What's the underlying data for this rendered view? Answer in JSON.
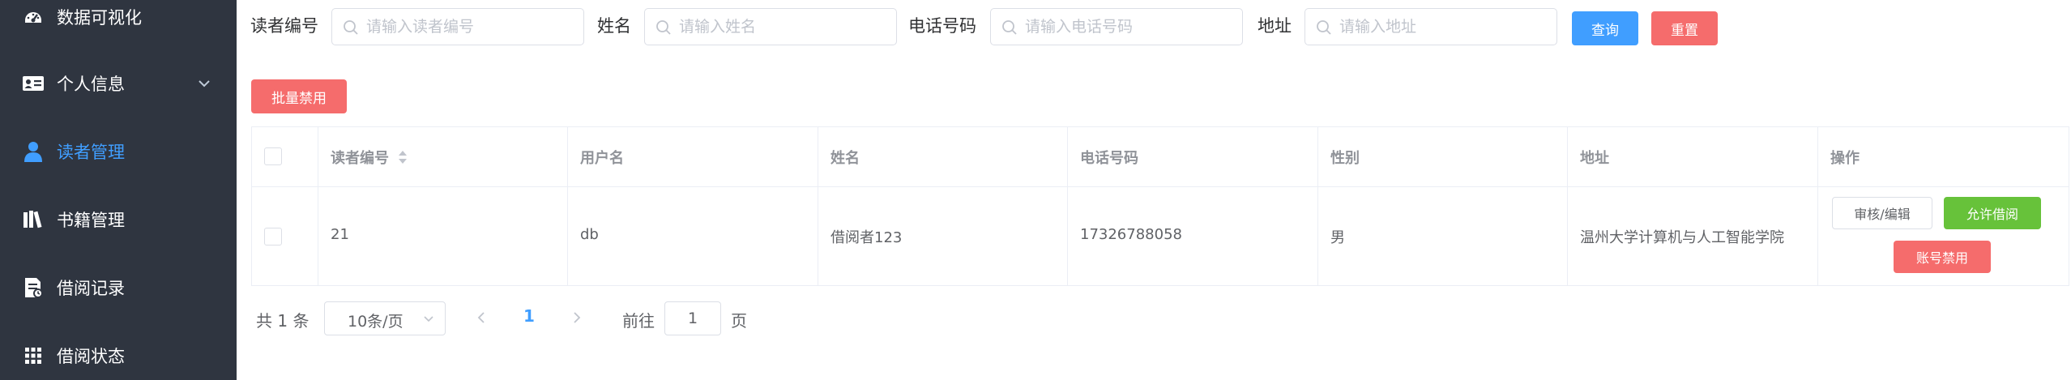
{
  "sidebar": {
    "items": [
      {
        "label": "数据可视化",
        "icon": "dashboard-icon"
      },
      {
        "label": "个人信息",
        "icon": "id-card-icon",
        "has_submenu": true
      },
      {
        "label": "读者管理",
        "icon": "user-icon",
        "active": true
      },
      {
        "label": "书籍管理",
        "icon": "books-icon"
      },
      {
        "label": "借阅记录",
        "icon": "document-icon"
      },
      {
        "label": "借阅状态",
        "icon": "grid-icon"
      }
    ]
  },
  "search": {
    "reader_id_label": "读者编号",
    "reader_id_placeholder": "请输入读者编号",
    "name_label": "姓名",
    "name_placeholder": "请输入姓名",
    "phone_label": "电话号码",
    "phone_placeholder": "请输入电话号码",
    "address_label": "地址",
    "address_placeholder": "请输入地址",
    "query_button": "查询",
    "reset_button": "重置"
  },
  "toolbar": {
    "batch_disable_button": "批量禁用"
  },
  "table": {
    "columns": [
      "读者编号",
      "用户名",
      "姓名",
      "电话号码",
      "性别",
      "地址",
      "操作"
    ],
    "rows": [
      {
        "reader_id": "21",
        "username": "db",
        "name": "借阅者123",
        "phone": "17326788058",
        "gender": "男",
        "address": "温州大学计算机与人工智能学院",
        "actions": {
          "edit": "审核/编辑",
          "allow": "允许借阅",
          "disable": "账号禁用"
        }
      }
    ]
  },
  "pagination": {
    "total_text": "共 1 条",
    "page_size": "10条/页",
    "current_page": "1",
    "goto_label": "前往",
    "goto_value": "1",
    "page_suffix": "页"
  },
  "colors": {
    "sidebar_bg": "#2f3540",
    "primary": "#409eff",
    "danger": "#f56c6c",
    "success": "#67c23a"
  }
}
